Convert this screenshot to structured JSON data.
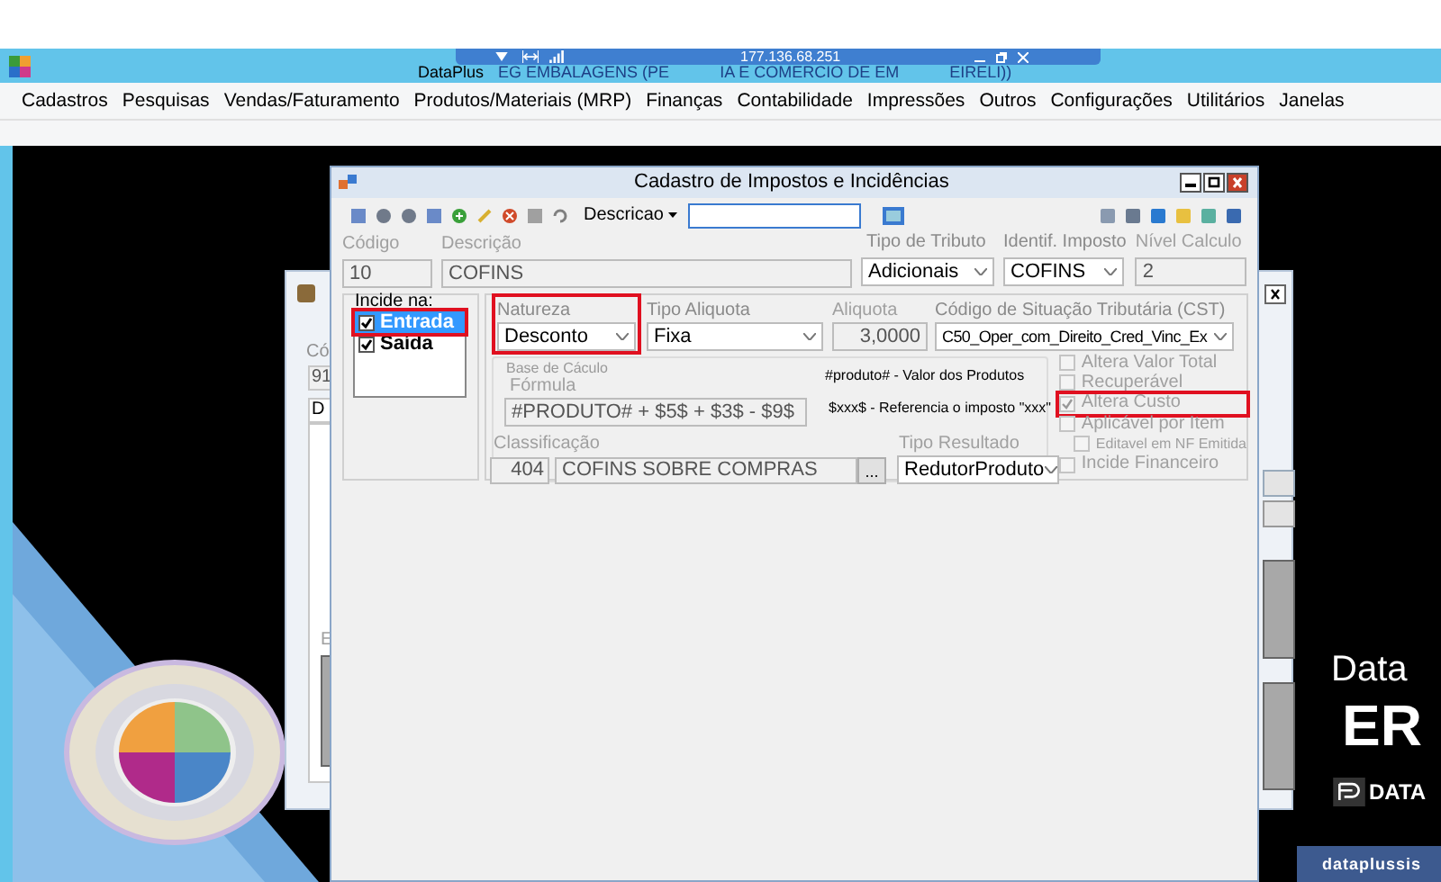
{
  "app_window": {
    "title_fragments": [
      "DataPlus",
      "EG EMBALAGENS  (PE",
      "IA E COMERCIO DE EM",
      "EIRELI))"
    ],
    "menu": [
      "Cadastros",
      "Pesquisas",
      "Vendas/Faturamento",
      "Produtos/Materiais (MRP)",
      "Finanças",
      "Contabilidade",
      "Impressões",
      "Outros",
      "Configurações",
      "Utilitários",
      "Janelas"
    ]
  },
  "remote_bar": {
    "address": "177.136.68.251"
  },
  "background_window": {
    "code_label": "Có",
    "code_value": "91",
    "tab": "D",
    "section_label": "E"
  },
  "dialog": {
    "title": "Cadastro de Impostos e Incidências",
    "toolbar": {
      "search_field": "Descricao"
    },
    "header_fields": [
      {
        "label": "Código",
        "value": "10",
        "kind": "text",
        "disabled": true
      },
      {
        "label": "Descrição",
        "value": "COFINS",
        "kind": "text",
        "disabled": true
      },
      {
        "label": "Tipo de Tributo",
        "value": "Adicionais",
        "kind": "select",
        "disabled": false
      },
      {
        "label": "Identif. Imposto",
        "value": "COFINS",
        "kind": "select",
        "disabled": false
      },
      {
        "label": "Nível Calculo",
        "value": "2",
        "kind": "text",
        "disabled": true
      }
    ],
    "incide_na": {
      "label": "Incide na:",
      "items": [
        {
          "label": "Entrada",
          "checked": true,
          "selected": true,
          "annotated": true
        },
        {
          "label": "Saída",
          "checked": true,
          "selected": false,
          "annotated": false
        }
      ]
    },
    "rate_fields": [
      {
        "label": "Natureza",
        "value": "Desconto",
        "kind": "select",
        "disabled": false,
        "annotated": true
      },
      {
        "label": "Tipo Aliquota",
        "value": "Fixa",
        "kind": "select",
        "disabled": false,
        "annotated": false
      },
      {
        "label": "Aliquota",
        "value": "3,0000",
        "kind": "number",
        "disabled": true,
        "annotated": false
      },
      {
        "label": "Código de Situação Tributária (CST)",
        "value": "C50_Oper_com_Direito_Cred_Vinc_Ex",
        "kind": "select",
        "disabled": false,
        "annotated": false
      }
    ],
    "base_calculo": {
      "title": "Base de Cáculo",
      "formula_label": "Fórmula",
      "formula": "#PRODUTO# + $5$ + $3$ - $9$",
      "hints": [
        "#produto# - Valor dos Produtos",
        "$xxx$ - Referencia o imposto \"xxx\""
      ]
    },
    "options": [
      {
        "label": "Altera Valor Total",
        "checked": false,
        "disabled": true,
        "annotated": false
      },
      {
        "label": "Recuperável",
        "checked": false,
        "disabled": true,
        "annotated": false
      },
      {
        "label": "Altera Custo",
        "checked": true,
        "disabled": true,
        "annotated": true
      },
      {
        "label": "Aplicável por Item",
        "checked": false,
        "disabled": true,
        "annotated": false,
        "children": [
          {
            "label": "Editavel em NF Emitida",
            "checked": false,
            "disabled": true,
            "annotated": false
          }
        ]
      },
      {
        "label": "Incide Financeiro",
        "checked": false,
        "disabled": true,
        "annotated": false
      }
    ],
    "classificacao": {
      "label": "Classificação",
      "code": "404",
      "value": "COFINS SOBRE COMPRAS",
      "button": "..."
    },
    "tipo_resultado": {
      "label": "Tipo Resultado",
      "value": "RedutorProduto"
    }
  },
  "desktop": {
    "brand_line1": "Data",
    "brand_line2": "ER",
    "logo_text": "DATA",
    "footer": "dataplussis"
  }
}
